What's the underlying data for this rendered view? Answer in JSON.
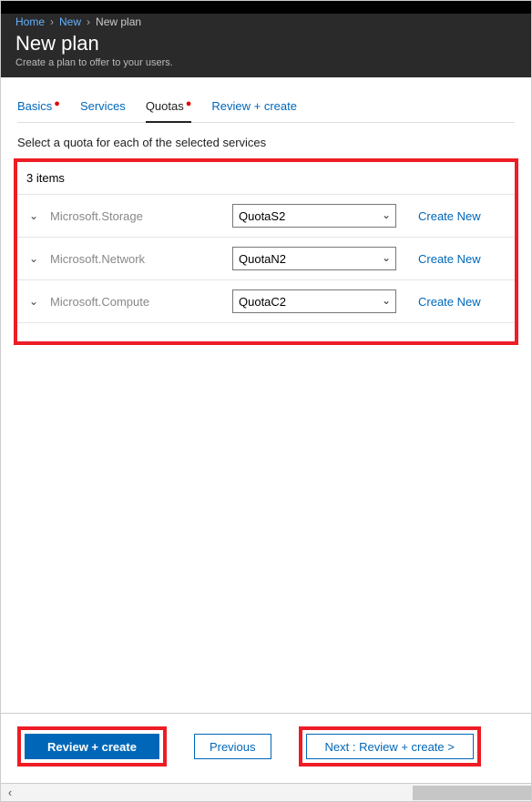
{
  "breadcrumb": {
    "home": "Home",
    "new": "New",
    "current": "New plan"
  },
  "header": {
    "title": "New plan",
    "subtitle": "Create a plan to offer to your users."
  },
  "tabs": {
    "basics": "Basics",
    "services": "Services",
    "quotas": "Quotas",
    "review": "Review + create"
  },
  "instruction": "Select a quota for each of the selected services",
  "count_label": "3 items",
  "rows": [
    {
      "name": "Microsoft.Storage",
      "value": "QuotaS2",
      "create": "Create New"
    },
    {
      "name": "Microsoft.Network",
      "value": "QuotaN2",
      "create": "Create New"
    },
    {
      "name": "Microsoft.Compute",
      "value": "QuotaC2",
      "create": "Create New"
    }
  ],
  "footer": {
    "review": "Review + create",
    "previous": "Previous",
    "next": "Next : Review + create >"
  }
}
